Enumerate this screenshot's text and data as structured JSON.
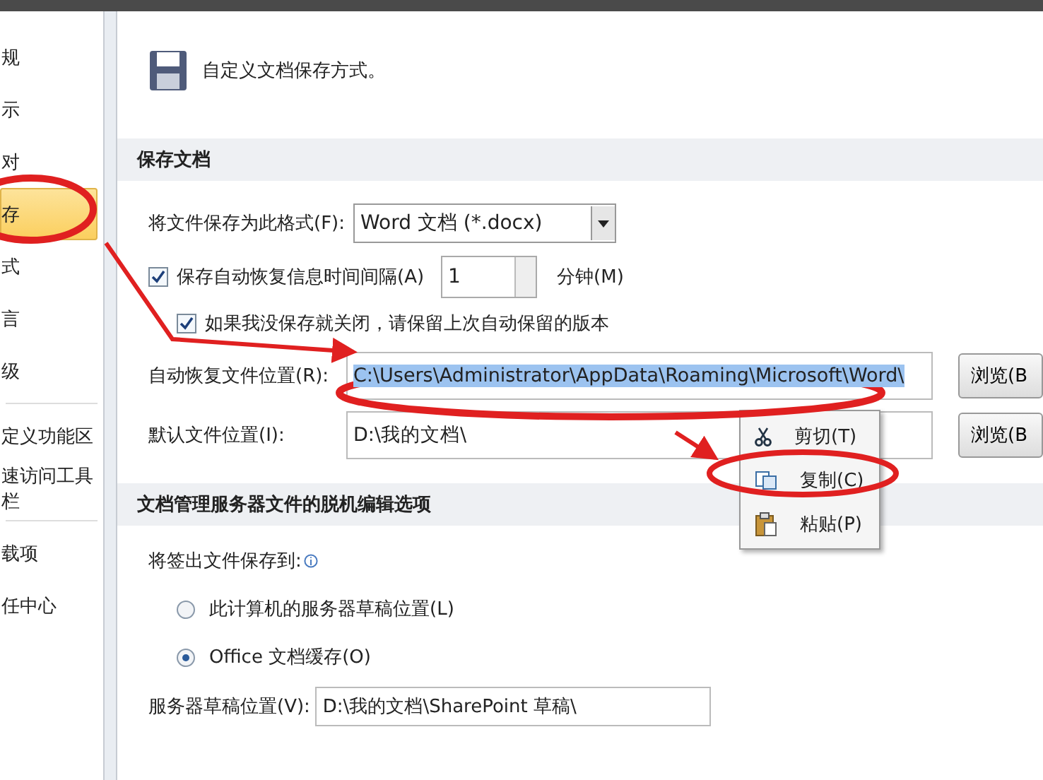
{
  "sidebar": {
    "items": [
      {
        "label": "规",
        "selected": false
      },
      {
        "label": "示",
        "selected": false
      },
      {
        "label": "对",
        "selected": false
      },
      {
        "label": "存",
        "selected": true
      },
      {
        "label": "式",
        "selected": false
      },
      {
        "label": "言",
        "selected": false
      },
      {
        "label": "级",
        "selected": false
      },
      {
        "label": "定义功能区",
        "selected": false
      },
      {
        "label": "速访问工具栏",
        "selected": false
      },
      {
        "label": "载项",
        "selected": false
      },
      {
        "label": "任中心",
        "selected": false
      }
    ]
  },
  "header": {
    "text": "自定义文档保存方式。"
  },
  "save_section": {
    "title": "保存文档",
    "format": {
      "label": "将文件保存为此格式(F):",
      "value": "Word 文档 (*.docx)"
    },
    "autosave": {
      "label": "保存自动恢复信息时间间隔(A)",
      "checked": true,
      "value": "1",
      "unit": "分钟(M)"
    },
    "keep_last": {
      "label": "如果我没保存就关闭，请保留上次自动保留的版本",
      "checked": true
    },
    "autorecover": {
      "label": "自动恢复文件位置(R):",
      "value": "C:\\Users\\Administrator\\AppData\\Roaming\\Microsoft\\Word\\",
      "highlighted": true,
      "button": "浏览(B"
    },
    "default_location": {
      "label": "默认文件位置(I):",
      "value": "D:\\我的文档\\",
      "button": "浏览(B"
    }
  },
  "context_menu": {
    "items": [
      {
        "kind": "cut",
        "label": "剪切(T)"
      },
      {
        "kind": "copy",
        "label": "复制(C)"
      },
      {
        "kind": "paste",
        "label": "粘贴(P)"
      }
    ]
  },
  "offline_section": {
    "title": "文档管理服务器文件的脱机编辑选项",
    "checkout_label": "将签出文件保存到:",
    "radios": [
      {
        "label": "此计算机的服务器草稿位置(L)",
        "selected": false
      },
      {
        "label": "Office 文档缓存(O)",
        "selected": true
      }
    ],
    "server_drafts": {
      "label": "服务器草稿位置(V):",
      "value": "D:\\我的文档\\SharePoint 草稿\\"
    }
  }
}
